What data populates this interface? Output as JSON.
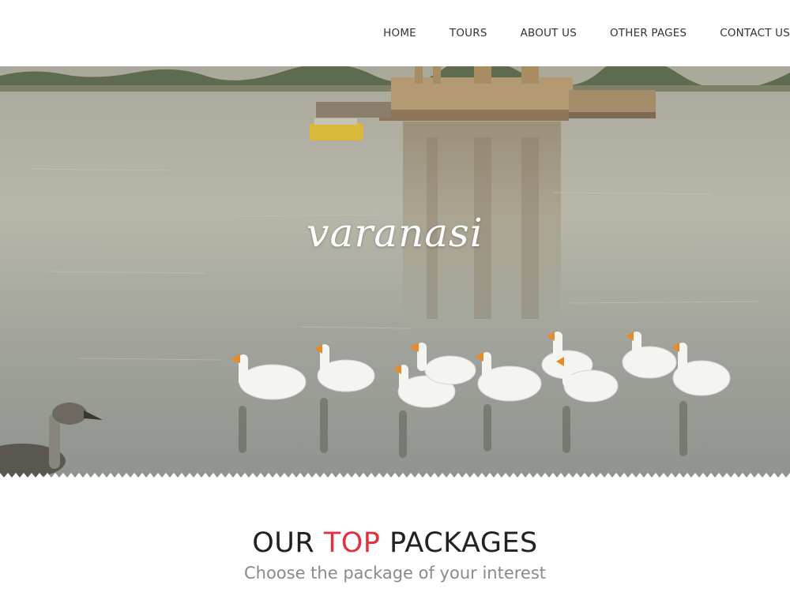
{
  "nav": {
    "items": [
      {
        "label": "HOME"
      },
      {
        "label": "TOURS"
      },
      {
        "label": "ABOUT US"
      },
      {
        "label": "OTHER PAGES"
      },
      {
        "label": "CONTACT US"
      }
    ]
  },
  "hero": {
    "title": "varanasi"
  },
  "packages": {
    "title_pre": "OUR ",
    "title_accent": "TOP",
    "title_post": " PACKAGES",
    "subtitle": "Choose the package of your interest"
  },
  "colors": {
    "accent": "#e2303f",
    "text": "#333333",
    "subtitle": "#8a8a8a"
  }
}
